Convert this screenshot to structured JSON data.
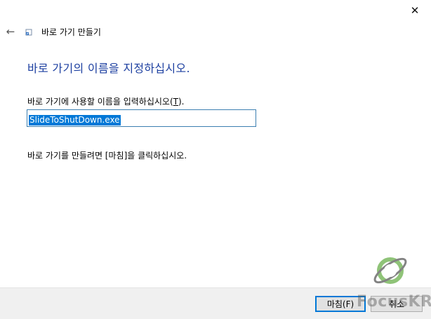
{
  "window": {
    "close_glyph": "✕"
  },
  "nav": {
    "back_glyph": "←",
    "wizard_title": "바로 가기 만들기"
  },
  "main": {
    "heading": "바로 가기의 이름을 지정하십시오.",
    "prompt_label_prefix": "바로 가기에 사용할 이름을 입력하십시오(",
    "prompt_label_accel": "T",
    "prompt_label_suffix": ").",
    "name_value": "SlideToShutDown.exe",
    "finish_hint": "바로 가기를 만들려면 [마침]을 클릭하십시오."
  },
  "footer": {
    "finish_label": "마침(F)",
    "cancel_label": "취소"
  },
  "watermark": {
    "text": "FocusKR"
  },
  "colors": {
    "heading": "#1c3fa0",
    "selection": "#0078d7",
    "input_border": "#3c7fb1",
    "footer_bg": "#f0f0f0"
  }
}
